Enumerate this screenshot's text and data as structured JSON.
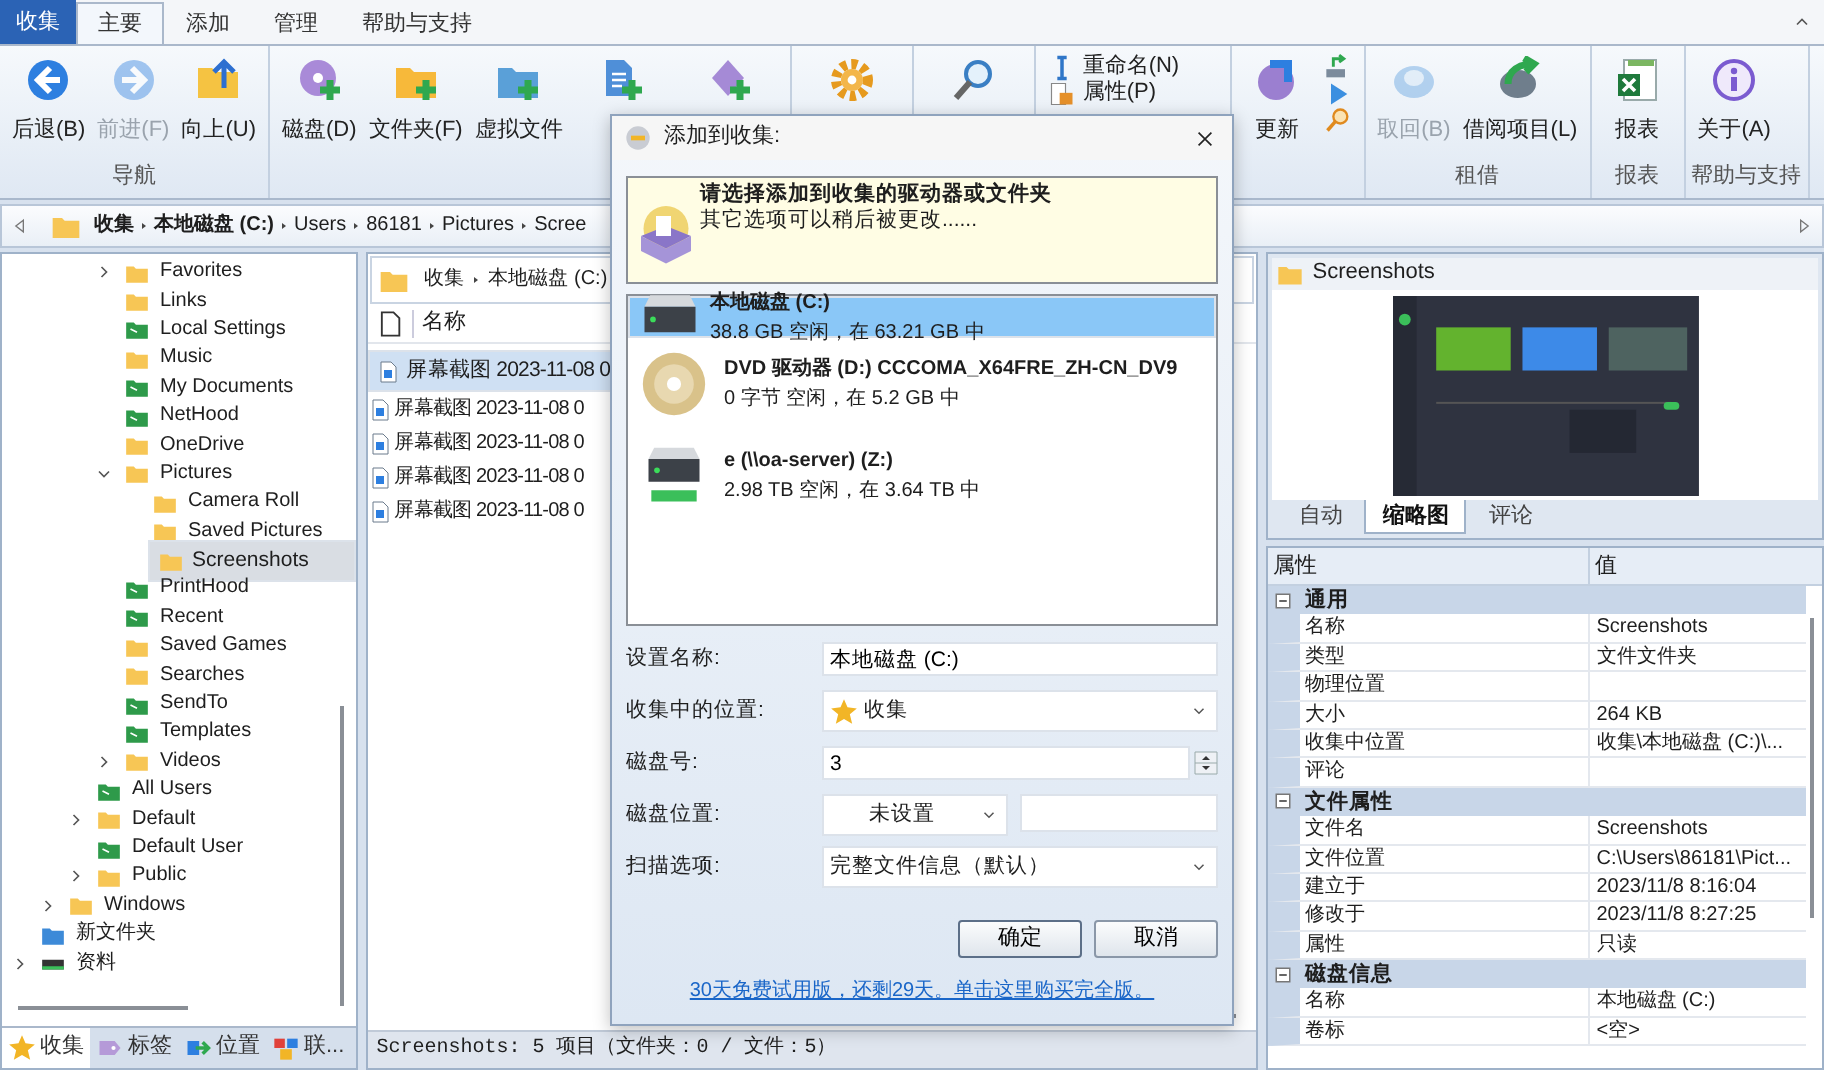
{
  "tabs": [
    {
      "label": "收集",
      "kind": "app",
      "selected": false
    },
    {
      "label": "主要",
      "kind": "tab",
      "selected": true
    },
    {
      "label": "添加",
      "kind": "tab",
      "selected": false
    },
    {
      "label": "管理",
      "kind": "tab",
      "selected": false
    },
    {
      "label": "帮助与支持",
      "kind": "tab",
      "selected": false
    }
  ],
  "ribbon": {
    "groups": [
      {
        "label": "导航",
        "buttons": [
          {
            "kind": "large",
            "label": "后退(B)",
            "disabled": false
          },
          {
            "kind": "large",
            "label": "前进(F)",
            "disabled": true
          },
          {
            "kind": "large",
            "label": "向上(U)",
            "disabled": false
          }
        ]
      },
      {
        "buttons": [
          {
            "kind": "large",
            "label": "磁盘(D)",
            "disabled": false
          },
          {
            "kind": "large",
            "label": "文件夹(F)",
            "disabled": false
          },
          {
            "kind": "large",
            "label": "虚拟文件",
            "disabled": false
          },
          {
            "kind": "large",
            "disabled": false
          },
          {
            "kind": "large",
            "disabled": false
          }
        ]
      },
      {
        "buttons": [
          {
            "kind": "large",
            "disabled": false
          }
        ]
      },
      {
        "buttons": [
          {
            "kind": "large",
            "disabled": false
          }
        ]
      },
      {
        "buttons": [
          {
            "kind": "stack",
            "items": [
              {
                "kind": "small",
                "label": "重命名(N)"
              },
              {
                "kind": "small",
                "label": "属性(P)"
              }
            ]
          }
        ]
      },
      {
        "buttons": [
          {
            "kind": "large",
            "label": "更新",
            "disabled": false
          },
          {
            "kind": "stack",
            "items": [
              {
                "kind": "icon"
              },
              {
                "kind": "icon"
              },
              {
                "kind": "icon"
              }
            ]
          }
        ]
      },
      {
        "label": "租借",
        "buttons": [
          {
            "kind": "large",
            "label": "取回(B)",
            "disabled": true
          },
          {
            "kind": "large",
            "label": "借阅项目(L)",
            "disabled": false
          }
        ]
      },
      {
        "label": "报表",
        "buttons": [
          {
            "kind": "large",
            "label": "报表",
            "disabled": false
          }
        ]
      },
      {
        "label": "帮助与支持",
        "buttons": [
          {
            "kind": "large",
            "label": "关于(A)",
            "disabled": false
          }
        ]
      }
    ]
  },
  "address": {
    "segments": [
      "收集",
      "本地磁盘 (C:)",
      "Users",
      "86181",
      "Pictures",
      "Scree"
    ]
  },
  "tree": {
    "items": [
      {
        "children": [
          {
            "children": [
              {
                "children": [
                  {
                    "label": "Favorites",
                    "kind": "folder",
                    "expanded": false,
                    "selected": false
                  },
                  {
                    "label": "Links",
                    "kind": "folder",
                    "selected": false
                  },
                  {
                    "label": "Local Settings",
                    "kind": "shared",
                    "selected": false
                  },
                  {
                    "label": "Music",
                    "kind": "folder",
                    "selected": false
                  },
                  {
                    "label": "My Documents",
                    "kind": "shared",
                    "selected": false
                  },
                  {
                    "label": "NetHood",
                    "kind": "shared",
                    "selected": false
                  },
                  {
                    "label": "OneDrive",
                    "kind": "folder",
                    "selected": false
                  },
                  {
                    "label": "Pictures",
                    "kind": "folder",
                    "expanded": true,
                    "selected": false,
                    "children": [
                      {
                        "label": "Camera Roll",
                        "kind": "folder",
                        "selected": false
                      },
                      {
                        "label": "Saved Pictures",
                        "kind": "folder",
                        "selected": false
                      },
                      {
                        "label": "Screenshots",
                        "kind": "folder",
                        "selected": true
                      }
                    ]
                  },
                  {
                    "label": "PrintHood",
                    "kind": "shared",
                    "selected": false
                  },
                  {
                    "label": "Recent",
                    "kind": "shared",
                    "selected": false
                  },
                  {
                    "label": "Saved Games",
                    "kind": "folder",
                    "selected": false
                  },
                  {
                    "label": "Searches",
                    "kind": "folder",
                    "selected": false
                  },
                  {
                    "label": "SendTo",
                    "kind": "shared",
                    "selected": false
                  },
                  {
                    "label": "Templates",
                    "kind": "shared",
                    "selected": false
                  },
                  {
                    "label": "Videos",
                    "kind": "folder",
                    "expanded": false,
                    "selected": false
                  }
                ]
              },
              {
                "label": "All Users",
                "kind": "shared",
                "selected": false
              },
              {
                "label": "Default",
                "kind": "folder",
                "expanded": false,
                "selected": false
              },
              {
                "label": "Default User",
                "kind": "shared",
                "selected": false
              },
              {
                "label": "Public",
                "kind": "folder",
                "expanded": false,
                "selected": false
              }
            ]
          },
          {
            "label": "Windows",
            "kind": "folder",
            "expanded": false,
            "selected": false
          }
        ]
      },
      {
        "label": "新文件夹",
        "kind": "special",
        "selected": false
      },
      {
        "label": "资料",
        "kind": "drive",
        "expanded": false,
        "selected": false
      }
    ]
  },
  "left_tabs": [
    {
      "label": "收集",
      "selected": true
    },
    {
      "label": "标签",
      "selected": false
    },
    {
      "label": "位置",
      "selected": false
    },
    {
      "label": "联...",
      "selected": false
    }
  ],
  "files": {
    "path": [
      "收集",
      "本地磁盘 (C:)"
    ],
    "columns": [
      "名称"
    ],
    "rows": [
      {
        "name": "屏幕截图 2023-11-08 0",
        "selected": true
      },
      {
        "name": "屏幕截图 2023-11-08 0",
        "selected": false
      },
      {
        "name": "屏幕截图 2023-11-08 0",
        "selected": false
      },
      {
        "name": "屏幕截图 2023-11-08 0",
        "selected": false
      },
      {
        "name": "屏幕截图 2023-11-08 0",
        "selected": false
      }
    ]
  },
  "status_bar": "Screenshots: 5 项目（文件夹：0 / 文件：5）",
  "preview": {
    "title": "Screenshots",
    "tabs": [
      {
        "label": "自动",
        "selected": false
      },
      {
        "label": "缩略图",
        "selected": true
      },
      {
        "label": "评论",
        "selected": false
      }
    ]
  },
  "properties": {
    "columns": [
      "属性",
      "值"
    ],
    "groups": [
      {
        "label": "通用",
        "expanded": true,
        "rows": [
          {
            "name": "名称",
            "value": "Screenshots"
          },
          {
            "name": "类型",
            "value": "文件文件夹"
          },
          {
            "name": "物理位置"
          },
          {
            "name": "大小",
            "value": "264 KB"
          },
          {
            "name": "收集中位置",
            "value": "收集\\本地磁盘 (C:)\\..."
          },
          {
            "name": "评论"
          }
        ]
      },
      {
        "label": "文件属性",
        "expanded": true,
        "rows": [
          {
            "name": "文件名",
            "value": "Screenshots"
          },
          {
            "name": "文件位置",
            "value": "C:\\Users\\86181\\Pict..."
          },
          {
            "name": "建立于",
            "value": "2023/11/8 8:16:04"
          },
          {
            "name": "修改于",
            "value": "2023/11/8 8:27:25"
          },
          {
            "name": "属性",
            "value": "只读"
          }
        ]
      },
      {
        "label": "磁盘信息",
        "expanded": true,
        "rows": [
          {
            "name": "名称",
            "value": "本地磁盘 (C:)"
          },
          {
            "name": "卷标",
            "value": "<空>"
          }
        ]
      }
    ]
  },
  "dialog": {
    "title": "添加到收集:",
    "banner": {
      "heading": "请选择添加到收集的驱动器或文件夹",
      "text": "其它选项可以稍后被更改......"
    },
    "drives": [
      {
        "kind": "hdd",
        "name": "本地磁盘 (C:)",
        "detail": "38.8 GB 空闲，在 63.21 GB 中",
        "selected": true
      },
      {
        "kind": "dvd",
        "name": "DVD 驱动器 (D:) CCCOMA_X64FRE_ZH-CN_DV9",
        "detail": "0 字节 空闲，在 5.2 GB 中",
        "selected": false
      },
      {
        "kind": "network",
        "name": "e (\\\\oa-server) (Z:)",
        "detail": "2.98 TB 空闲，在 3.64 TB 中",
        "selected": false
      }
    ],
    "fields": [
      {
        "label": "设置名称:",
        "kind": "text",
        "value": "本地磁盘 (C:)"
      },
      {
        "label": "收集中的位置:",
        "kind": "location",
        "value": "收集"
      },
      {
        "label": "磁盘号:",
        "kind": "spin",
        "value": "3"
      },
      {
        "label": "磁盘位置:",
        "kind": "select_pair",
        "value": "未设置"
      },
      {
        "label": "扫描选项:",
        "kind": "select",
        "value": "完整文件信息（默认）"
      }
    ],
    "buttons": [
      "确定",
      "取消"
    ],
    "link": "30天免费试用版，还剩29天。单击这里购买完全版。"
  }
}
